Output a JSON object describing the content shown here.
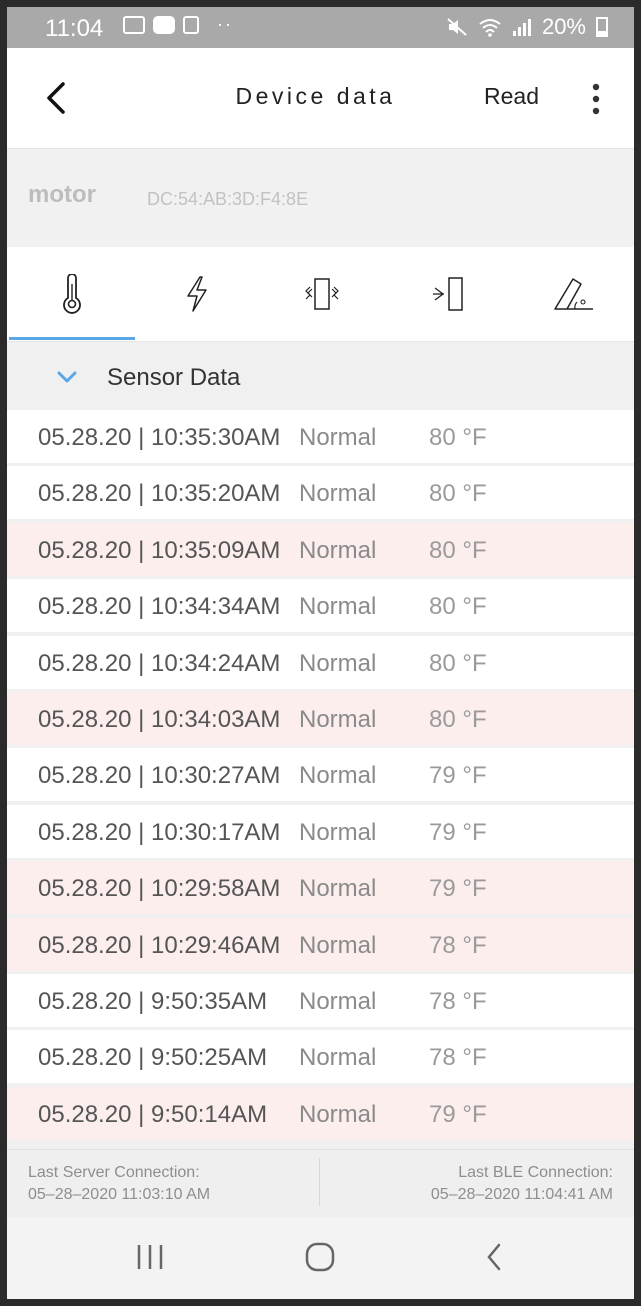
{
  "status_bar": {
    "time": "11:04",
    "dots": "··",
    "battery": "20%",
    "icons": [
      "image-icon",
      "youtube-icon",
      "screenshot-icon",
      "mute-icon",
      "wifi-icon",
      "signal-icon",
      "battery-icon"
    ]
  },
  "app_bar": {
    "title": "Device data",
    "read_label": "Read"
  },
  "device": {
    "name": "motor",
    "mac": "DC:54:AB:3D:F4:8E"
  },
  "tabs": [
    {
      "icon": "thermometer-icon",
      "selected": true
    },
    {
      "icon": "lightning-icon",
      "selected": false
    },
    {
      "icon": "vibration-icon",
      "selected": false
    },
    {
      "icon": "proximity-icon",
      "selected": false
    },
    {
      "icon": "tilt-angle-icon",
      "selected": false
    }
  ],
  "section": {
    "label": "Sensor Data"
  },
  "rows": [
    {
      "ts": "05.28.20 | 10:35:30AM",
      "status": "Normal",
      "value": "80 °F",
      "highlight": false
    },
    {
      "ts": "05.28.20 | 10:35:20AM",
      "status": "Normal",
      "value": "80 °F",
      "highlight": false
    },
    {
      "ts": "05.28.20 | 10:35:09AM",
      "status": "Normal",
      "value": "80 °F",
      "highlight": true
    },
    {
      "ts": "05.28.20 | 10:34:34AM",
      "status": "Normal",
      "value": "80 °F",
      "highlight": false
    },
    {
      "ts": "05.28.20 | 10:34:24AM",
      "status": "Normal",
      "value": "80 °F",
      "highlight": false
    },
    {
      "ts": "05.28.20 | 10:34:03AM",
      "status": "Normal",
      "value": "80 °F",
      "highlight": true
    },
    {
      "ts": "05.28.20 | 10:30:27AM",
      "status": "Normal",
      "value": "79 °F",
      "highlight": false
    },
    {
      "ts": "05.28.20 | 10:30:17AM",
      "status": "Normal",
      "value": "79 °F",
      "highlight": false
    },
    {
      "ts": "05.28.20 | 10:29:58AM",
      "status": "Normal",
      "value": "79 °F",
      "highlight": true
    },
    {
      "ts": "05.28.20 | 10:29:46AM",
      "status": "Normal",
      "value": "78 °F",
      "highlight": true
    },
    {
      "ts": "05.28.20 | 9:50:35AM",
      "status": "Normal",
      "value": "78 °F",
      "highlight": false
    },
    {
      "ts": "05.28.20 | 9:50:25AM",
      "status": "Normal",
      "value": "78 °F",
      "highlight": false
    },
    {
      "ts": "05.28.20 | 9:50:14AM",
      "status": "Normal",
      "value": "79 °F",
      "highlight": true
    }
  ],
  "footer": {
    "server_label": "Last Server Connection:",
    "server_time": "05–28–2020 11:03:10 AM",
    "ble_label": "Last BLE Connection:",
    "ble_time": "05–28–2020 11:04:41 AM"
  },
  "colors": {
    "accent": "#5aa6e6",
    "highlight_row": "#fdeeee",
    "status_bar": "#a9a9a9"
  }
}
